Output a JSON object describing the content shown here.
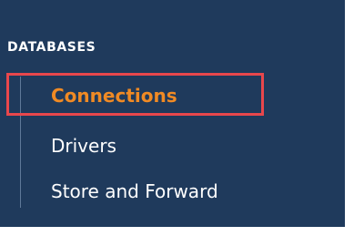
{
  "section": {
    "title": "DATABASES"
  },
  "nav": {
    "items": [
      {
        "label": "Connections",
        "active": true
      },
      {
        "label": "Drivers",
        "active": false
      },
      {
        "label": "Store and Forward",
        "active": false
      }
    ]
  },
  "colors": {
    "panel_background": "#1f3a5c",
    "active_text": "#f08a24",
    "text": "#ffffff",
    "highlight_border": "#e8474c",
    "tree_line": "#5f7898"
  }
}
